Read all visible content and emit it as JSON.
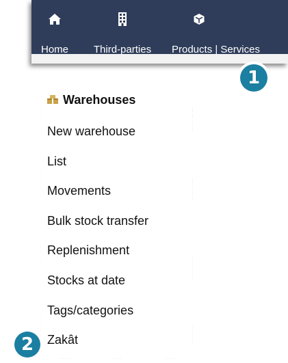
{
  "nav": {
    "items": [
      {
        "label": "Home",
        "icon": "home-icon"
      },
      {
        "label": "Third-parties",
        "icon": "building-icon"
      },
      {
        "label": "Products | Services",
        "icon": "cube-icon"
      }
    ],
    "background": "#2f3d5a"
  },
  "menu": {
    "title": "Warehouses",
    "title_icon": "boxes-icon",
    "items": [
      {
        "label": "New warehouse"
      },
      {
        "label": "List"
      },
      {
        "label": "Movements"
      },
      {
        "label": "Bulk stock transfer"
      },
      {
        "label": "Replenishment"
      },
      {
        "label": "Stocks at date"
      },
      {
        "label": "Tags/categories"
      },
      {
        "label": "Zakât"
      }
    ]
  },
  "steps": {
    "step1": "1",
    "step2": "2",
    "color": "#1b7fa1"
  }
}
